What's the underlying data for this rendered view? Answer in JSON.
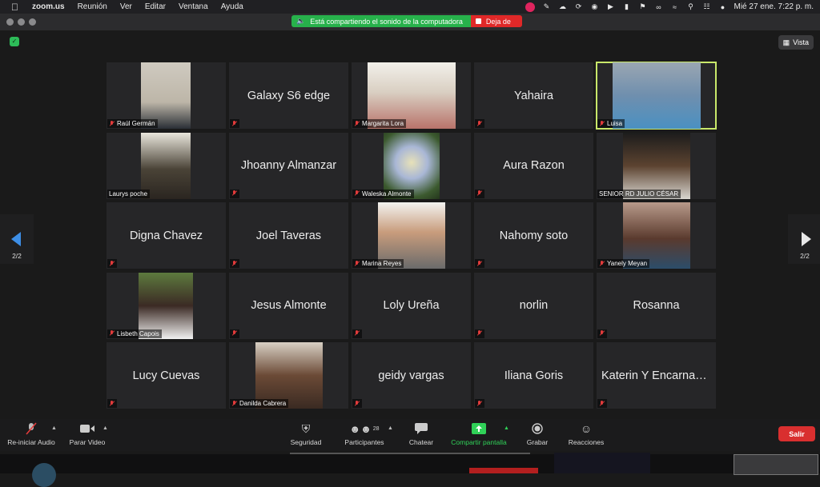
{
  "menubar": {
    "app_name": "zoom.us",
    "items": [
      "Reunión",
      "Ver",
      "Editar",
      "Ventana",
      "Ayuda"
    ],
    "clock": "Mié 27 ene.  7:22 p. m."
  },
  "share_banner": {
    "message": "Está compartiendo el sonido de la computadora",
    "stop_label": "Deja de"
  },
  "view_button": {
    "label": "Vista"
  },
  "pager": {
    "left_label": "2/2",
    "right_label": "2/2"
  },
  "participants": [
    {
      "name": "Raúl Germán",
      "has_video": true,
      "muted": true
    },
    {
      "name": "Galaxy S6 edge",
      "has_video": false,
      "muted": true
    },
    {
      "name": "Margarita Lora",
      "has_video": true,
      "muted": true
    },
    {
      "name": "Yahaira",
      "has_video": false,
      "muted": true
    },
    {
      "name": "Luisa",
      "has_video": true,
      "muted": true,
      "speaking": true
    },
    {
      "name": "Laurys poche",
      "has_video": true,
      "muted": false
    },
    {
      "name": "Jhoanny Almanzar",
      "has_video": false,
      "muted": true
    },
    {
      "name": "Waleska Almonte",
      "has_video": true,
      "muted": true
    },
    {
      "name": "Aura Razon",
      "has_video": false,
      "muted": true
    },
    {
      "name": "SENIOR RD JULIO CÉSAR",
      "has_video": true,
      "muted": false
    },
    {
      "name": "Digna Chavez",
      "has_video": false,
      "muted": true
    },
    {
      "name": "Joel Taveras",
      "has_video": false,
      "muted": true
    },
    {
      "name": "Marina Reyes",
      "has_video": true,
      "muted": true
    },
    {
      "name": "Nahomy soto",
      "has_video": false,
      "muted": true
    },
    {
      "name": "Yanely Meyan",
      "has_video": true,
      "muted": true
    },
    {
      "name": "Lisbeth Capois",
      "has_video": true,
      "muted": true
    },
    {
      "name": "Jesus Almonte",
      "has_video": false,
      "muted": true
    },
    {
      "name": "Loly Ureña",
      "has_video": false,
      "muted": true
    },
    {
      "name": "norlin",
      "has_video": false,
      "muted": true
    },
    {
      "name": "Rosanna",
      "has_video": false,
      "muted": true
    },
    {
      "name": "Lucy Cuevas",
      "has_video": false,
      "muted": true
    },
    {
      "name": "Danilda Cabrera",
      "has_video": true,
      "muted": true
    },
    {
      "name": "geidy vargas",
      "has_video": false,
      "muted": true
    },
    {
      "name": "Iliana Goris",
      "has_video": false,
      "muted": true
    },
    {
      "name": "Katerin Y Encarnaci...",
      "has_video": false,
      "muted": true
    }
  ],
  "toolbar": {
    "audio_label": "Re-iniciar Audio",
    "video_label": "Parar Video",
    "security_label": "Seguridad",
    "participants_label": "Participantes",
    "participants_count": "28",
    "chat_label": "Chatear",
    "share_label": "Compartir pantalla",
    "record_label": "Grabar",
    "reactions_label": "Reacciones",
    "leave_label": "Salir"
  },
  "colors": {
    "share_green": "#27b14b",
    "stop_red": "#e02828",
    "speaking_outline": "#c9e86a",
    "leave_red": "#d92f2f",
    "pager_arrow": "#3d8ee6"
  }
}
